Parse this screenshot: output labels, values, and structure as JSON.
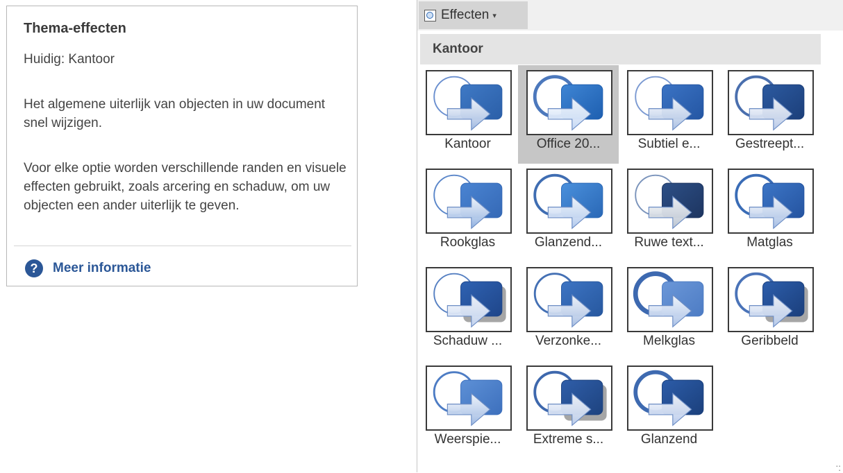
{
  "tooltip": {
    "title": "Thema-effecten",
    "current": "Huidig: Kantoor",
    "para1": "Het algemene uiterlijk van objecten in uw document snel wijzigen.",
    "para2": "Voor elke optie worden verschillende randen en visuele effecten gebruikt, zoals arcering en schaduw, om uw objecten een ander uiterlijk te geven.",
    "help_icon": "question-circle-icon",
    "help_link": "Meer informatie"
  },
  "toolbar": {
    "button_label": "Effecten",
    "button_icon": "effects-icon",
    "caret": "▾"
  },
  "gallery": {
    "section": "Kantoor",
    "selected_index": 1,
    "items": [
      {
        "label": "Kantoor"
      },
      {
        "label": "Office 20..."
      },
      {
        "label": "Subtiel e..."
      },
      {
        "label": "Gestreept..."
      },
      {
        "label": "Rookglas"
      },
      {
        "label": "Glanzend..."
      },
      {
        "label": "Ruwe text..."
      },
      {
        "label": "Matglas"
      },
      {
        "label": "Schaduw ..."
      },
      {
        "label": "Verzonke..."
      },
      {
        "label": "Melkglas"
      },
      {
        "label": "Geribbeld"
      },
      {
        "label": "Weerspie..."
      },
      {
        "label": "Extreme s..."
      },
      {
        "label": "Glanzend"
      }
    ]
  },
  "colors": {
    "accent": "#2b5797",
    "selected_tile": "#c6c6c6",
    "header_bg": "#e4e4e4"
  }
}
